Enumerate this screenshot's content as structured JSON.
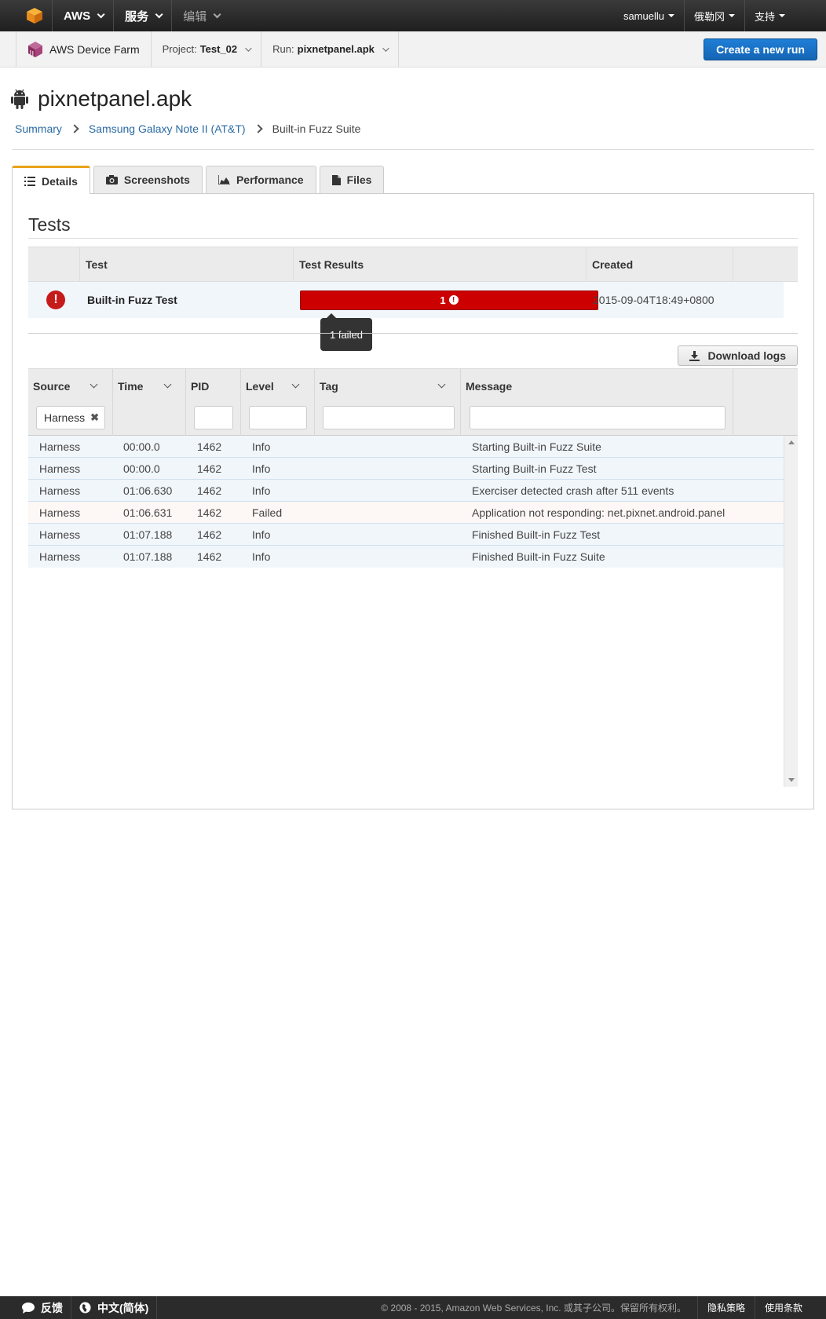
{
  "topnav": {
    "brand": "AWS",
    "services": "服务",
    "edit": "编辑",
    "user": "samuellu",
    "region": "俄勒冈",
    "support": "支持"
  },
  "subbar": {
    "app_name": "AWS Device Farm",
    "project_label": "Project:",
    "project_value": "Test_02",
    "run_label": "Run:",
    "run_value": "pixnetpanel.apk",
    "create_label": "Create a new run"
  },
  "page": {
    "title": "pixnetpanel.apk",
    "breadcrumb": [
      "Summary",
      "Samsung Galaxy Note II (AT&T)",
      "Built-in Fuzz Suite"
    ]
  },
  "tabs": [
    "Details",
    "Screenshots",
    "Performance",
    "Files"
  ],
  "tests": {
    "heading": "Tests",
    "columns": [
      "Test",
      "Test Results",
      "Created"
    ],
    "row": {
      "name": "Built-in Fuzz Test",
      "result_count": "1",
      "created": "2015-09-04T18:49+0800"
    },
    "tooltip": "1 failed"
  },
  "logs": {
    "download_label": "Download logs",
    "columns": [
      "Source",
      "Time",
      "PID",
      "Level",
      "Tag",
      "Message"
    ],
    "source_filter": "Harness",
    "rows": [
      {
        "source": "Harness",
        "time": "00:00.0",
        "pid": "1462",
        "level": "Info",
        "tag": "",
        "message": "Starting Built-in Fuzz Suite"
      },
      {
        "source": "Harness",
        "time": "00:00.0",
        "pid": "1462",
        "level": "Info",
        "tag": "",
        "message": "Starting Built-in Fuzz Test"
      },
      {
        "source": "Harness",
        "time": "01:06.630",
        "pid": "1462",
        "level": "Info",
        "tag": "",
        "message": "Exerciser detected crash after 511 events"
      },
      {
        "source": "Harness",
        "time": "01:06.631",
        "pid": "1462",
        "level": "Failed",
        "tag": "",
        "message": "Application not responding: net.pixnet.android.panel"
      },
      {
        "source": "Harness",
        "time": "01:07.188",
        "pid": "1462",
        "level": "Info",
        "tag": "",
        "message": "Finished Built-in Fuzz Test"
      },
      {
        "source": "Harness",
        "time": "01:07.188",
        "pid": "1462",
        "level": "Info",
        "tag": "",
        "message": "Finished Built-in Fuzz Suite"
      }
    ]
  },
  "footer": {
    "feedback": "反馈",
    "language": "中文(简体)",
    "copyright": "© 2008 - 2015, Amazon Web Services, Inc. 或其子公司。保留所有权利。",
    "privacy": "隐私策略",
    "terms": "使用条款"
  },
  "colors": {
    "accent": "#1565b4",
    "fail": "#cc0000",
    "tab_active": "#e8a317"
  }
}
